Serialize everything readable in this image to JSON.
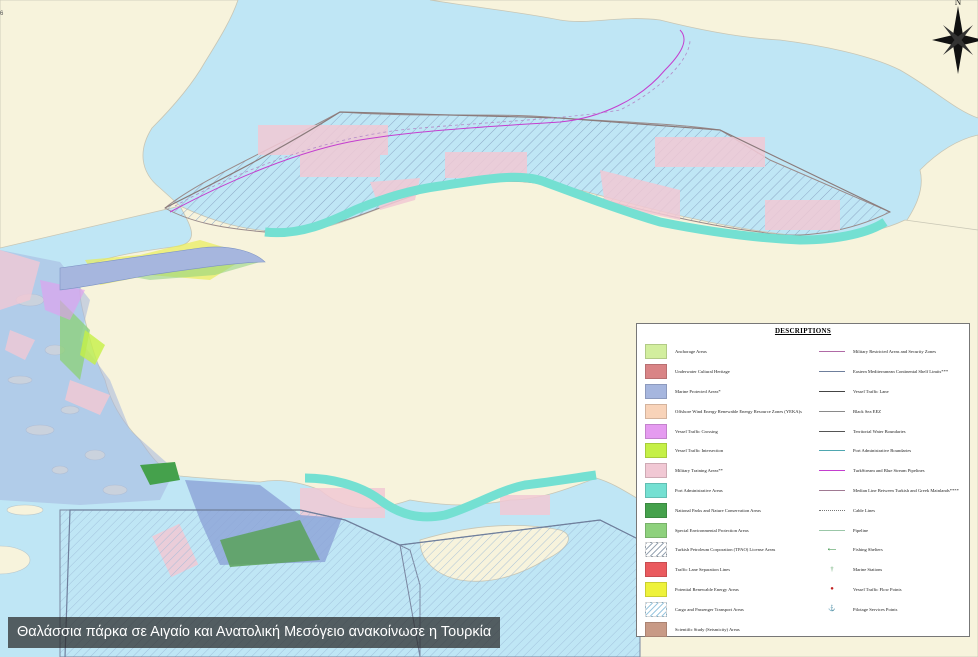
{
  "page_number": "6",
  "compass_label": "N",
  "caption": "Θαλάσσια πάρκα σε Αιγαίο και Ανατολική Μεσόγειο ανακοίνωσε η Τουρκία",
  "legend": {
    "title": "DESCRIPTIONS",
    "left": [
      {
        "label": "Anchorage Areas",
        "color": "#d2ee9e"
      },
      {
        "label": "Underwater Cultural Heritage",
        "color": "#d98486"
      },
      {
        "label": "Marine Protected Areas*",
        "color": "#a6b6de"
      },
      {
        "label": "Offshore Wind Energy Renewable Energy Resource Zones (YEKA)s",
        "color": "#f8d3b9"
      },
      {
        "label": "Vessel Traffic Crossing",
        "color": "#e59bf0"
      },
      {
        "label": "Vessel Traffic Intersection",
        "color": "#c5f046"
      },
      {
        "label": "Military Training Areas**",
        "color": "#f1c8d4"
      },
      {
        "label": "Port Administrative Areas",
        "color": "#74e0d2"
      },
      {
        "label": "National Parks and Nature Conservation Areas",
        "color": "#45a14c"
      },
      {
        "label": "Special Environmental Protection Areas",
        "color": "#8ed17d"
      },
      {
        "label": "Turkish Petroleum Corporation (TPAO) License Areas",
        "color": "hatch"
      },
      {
        "label": "Traffic Lane Separation Lines",
        "color": "#ea5a5e"
      },
      {
        "label": "Potential Renewable Energy Areas",
        "color": "#eef23a"
      },
      {
        "label": "Cargo and Passenger Transport Areas",
        "color": "hatch2"
      },
      {
        "label": "Scientific Study (Seismicity) Areas",
        "color": "#c89a86"
      }
    ],
    "right": [
      {
        "label": "Military Restricted Areas and Security Zones",
        "style": "line",
        "color": "#b06aa6"
      },
      {
        "label": "Eastern Mediterranean Continental Shelf Limits***",
        "style": "line",
        "color": "#6f7f9c"
      },
      {
        "label": "Vessel Traffic Lane",
        "style": "line",
        "color": "#444444"
      },
      {
        "label": "Black Sea EEZ",
        "style": "line",
        "color": "#8a8a8a"
      },
      {
        "label": "Territorial Water Boundaries",
        "style": "line",
        "color": "#555555"
      },
      {
        "label": "Port Administrative Boundaries",
        "style": "line",
        "color": "#4fa7b0"
      },
      {
        "label": "TurkStream and Blue Stream Pipelines",
        "style": "line",
        "color": "#c43ecf"
      },
      {
        "label": "Median Line Between Turkish and Greek Mainlands****",
        "style": "line",
        "color": "#a07a92"
      },
      {
        "label": "Cable Lines",
        "style": "dotted",
        "color": "#777777"
      },
      {
        "label": "Pipeline",
        "style": "line",
        "color": "#9bc7a8"
      },
      {
        "label": "Fishing Shelters",
        "style": "symbol",
        "glyph": "⟵",
        "color": "#2a8a3a"
      },
      {
        "label": "Marine Stations",
        "style": "symbol",
        "glyph": "†",
        "color": "#2a8a3a"
      },
      {
        "label": "Vessel Traffic Flow Points",
        "style": "symbol",
        "glyph": "●",
        "color": "#c22222"
      },
      {
        "label": "Pilotage Services Points",
        "style": "symbol",
        "glyph": "⚓",
        "color": "#5aa0a0"
      }
    ]
  }
}
